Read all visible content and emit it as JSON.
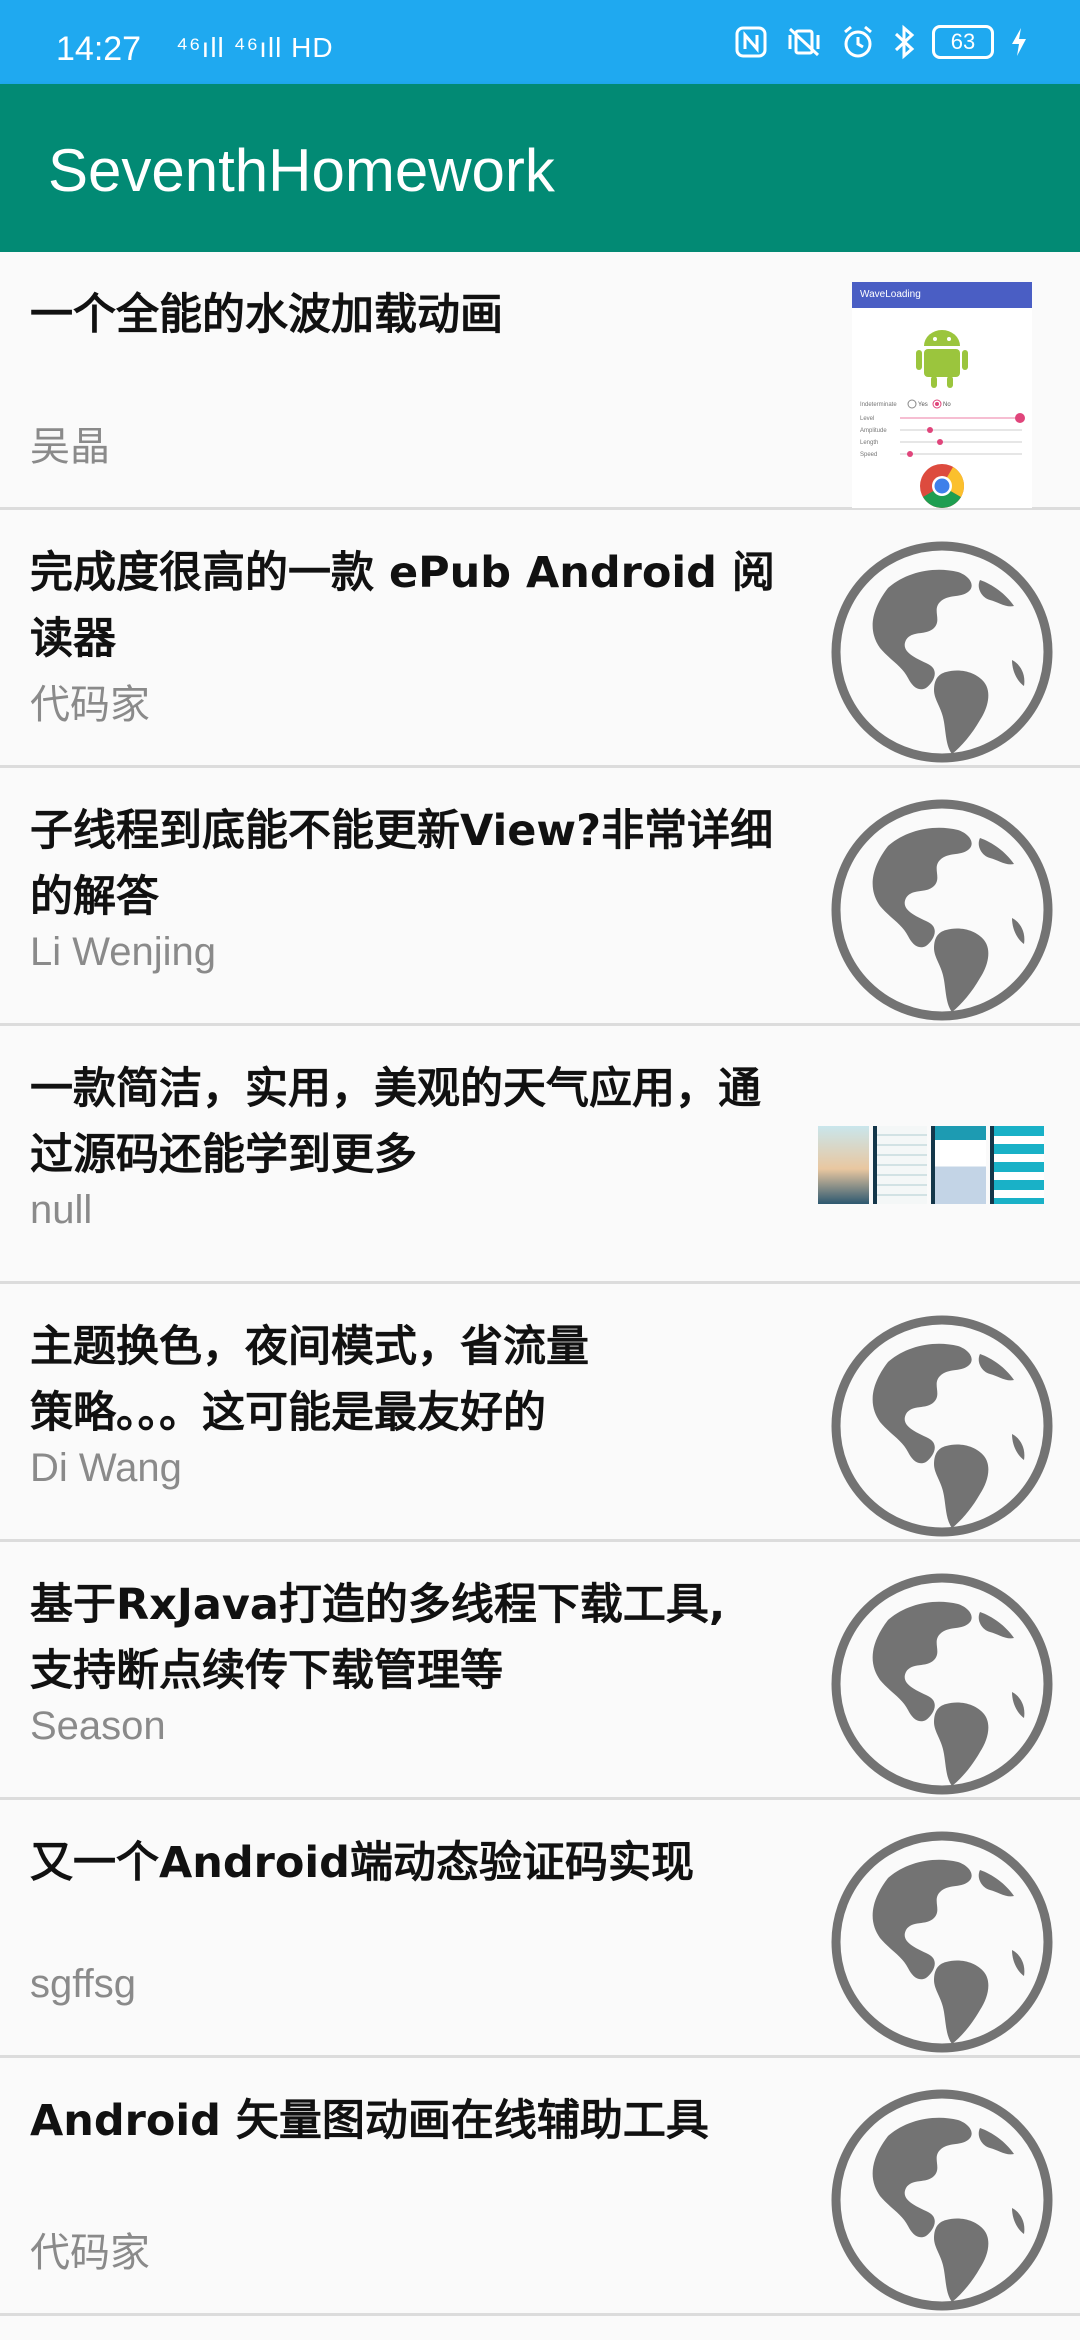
{
  "status_bar": {
    "time": "14:27",
    "network": "⁴⁶ıll ⁴⁶ıll HD",
    "battery": "63"
  },
  "app_bar": {
    "title": "SeventhHomework"
  },
  "items": [
    {
      "title": "一个全能的水波加载动画",
      "author": "吴晶",
      "thumb": "waveloading-screenshot"
    },
    {
      "title": "完成度很高的一款 ePub Android 阅读器",
      "author": "代码家",
      "thumb": "globe-icon"
    },
    {
      "title": "子线程到底能不能更新View?非常详细的解答",
      "author": "Li Wenjing",
      "thumb": "globe-icon"
    },
    {
      "title": "一款简洁，实用，美观的天气应用，通过源码还能学到更多",
      "author": "null",
      "thumb": "weather-app-screenshots"
    },
    {
      "title": "主题换色，夜间模式，省流量策略。。。这可能是最友好的",
      "author": "Di Wang",
      "thumb": "globe-icon"
    },
    {
      "title": "基于RxJava打造的多线程下载工具,支持断点续传下载管理等",
      "author": "Season",
      "thumb": "globe-icon"
    },
    {
      "title": "又一个Android端动态验证码实现",
      "author": "sgffsg",
      "thumb": "globe-icon"
    },
    {
      "title": "Android 矢量图动画在线辅助工具",
      "author": "代码家",
      "thumb": "globe-icon"
    }
  ],
  "waveloading": {
    "header": "WaveLoading",
    "indeterminate_label": "Indeterminate",
    "yes": "Yes",
    "no": "No",
    "sliders": [
      "Level",
      "Amplitude",
      "Length",
      "Speed"
    ]
  },
  "colors": {
    "status_bar": "#1fa9f0",
    "app_bar": "#028a74",
    "globe": "#737373",
    "author_text": "#8a8a8a"
  }
}
